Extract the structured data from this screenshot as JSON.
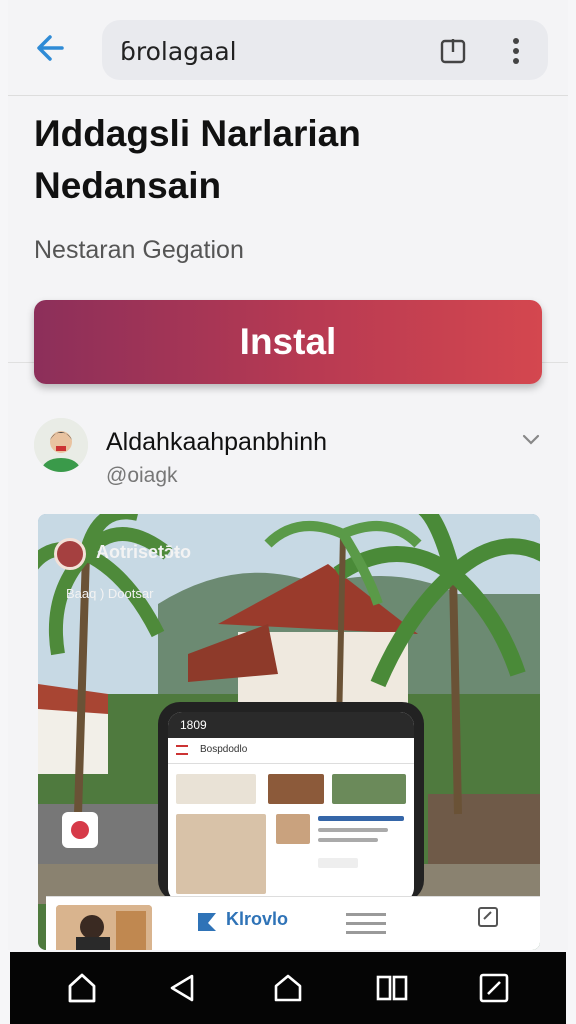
{
  "browser": {
    "url": "ɓrolagaal",
    "back_icon": "arrow-left-icon",
    "share_icon": "share-icon",
    "more_icon": "more-vertical-icon"
  },
  "app": {
    "title": "Иddagsli Narlarian Nedansain",
    "subtitle": "Nestaran Gegation",
    "install_label": "Instal"
  },
  "developer": {
    "name": "Aldahkaahpanbhinh",
    "handle": "@oiagk"
  },
  "hero": {
    "badge_title": "Aotrisetɔ̄ŧo",
    "badge_sub": "Baaq ) Dootsar",
    "phone_time": "1809",
    "phone_title": "Bospdodlo",
    "brand": "Klrovlo"
  },
  "navbar": {
    "items": [
      "home-icon",
      "back-triangle-icon",
      "home-outline-icon",
      "recents-icon",
      "edit-square-icon"
    ]
  },
  "colors": {
    "install_gradient_start": "#8c2f5a",
    "install_gradient_end": "#d4474f",
    "link_blue": "#2f8bd6"
  }
}
